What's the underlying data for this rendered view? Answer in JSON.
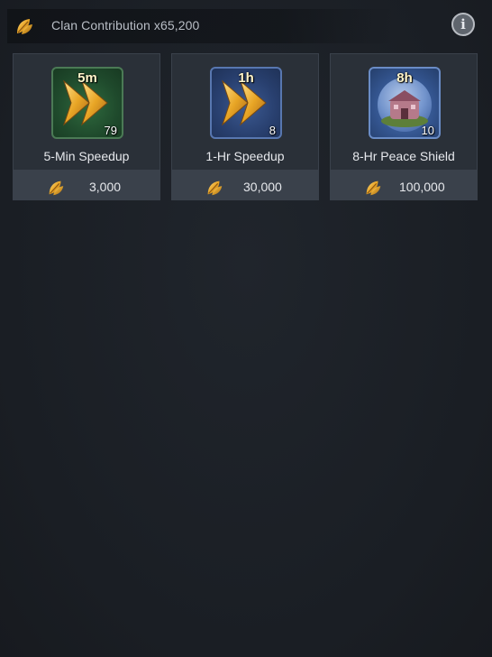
{
  "header": {
    "contribution_text": "Clan Contribution x65,200",
    "info_glyph": "i",
    "currency_icon": "leaf-icon"
  },
  "items": [
    {
      "badge": "5m",
      "count": "79",
      "name": "5-Min Speedup",
      "price": "3,000",
      "icon": "fast-forward-icon",
      "frame_color": "#2f6a3e"
    },
    {
      "badge": "1h",
      "count": "8",
      "name": "1-Hr Speedup",
      "price": "30,000",
      "icon": "fast-forward-icon",
      "frame_color": "#3c5a92"
    },
    {
      "badge": "8h",
      "count": "10",
      "name": "8-Hr Peace Shield",
      "price": "100,000",
      "icon": "peace-shield-icon",
      "frame_color": "#4f77b8"
    }
  ],
  "colors": {
    "background": "#1c2026",
    "card": "#2a3038",
    "card_footer": "#3a414b",
    "gold": "#e8a525"
  }
}
